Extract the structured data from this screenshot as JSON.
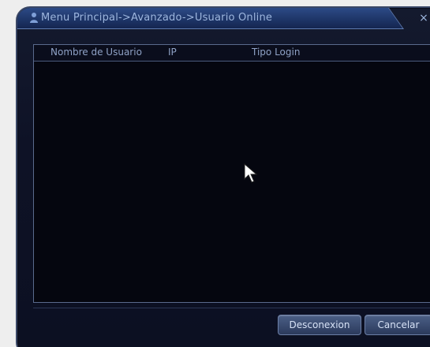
{
  "window": {
    "title": "Menu Principal->Avanzado->Usuario Online",
    "close_glyph": "×",
    "colors": {
      "title_bar": "#1d3466",
      "title_text": "#9db6de",
      "panel_bg": "#05060f",
      "border": "#5a6a8c"
    }
  },
  "list": {
    "columns": [
      {
        "label": "Nombre de Usuario"
      },
      {
        "label": "IP"
      },
      {
        "label": "Tipo Login"
      }
    ],
    "rows": []
  },
  "buttons": {
    "disconnect": "Desconexion",
    "cancel": "Cancelar"
  },
  "icons": {
    "title": "user-icon",
    "close": "close-icon",
    "cursor": "pointer-cursor-icon"
  }
}
